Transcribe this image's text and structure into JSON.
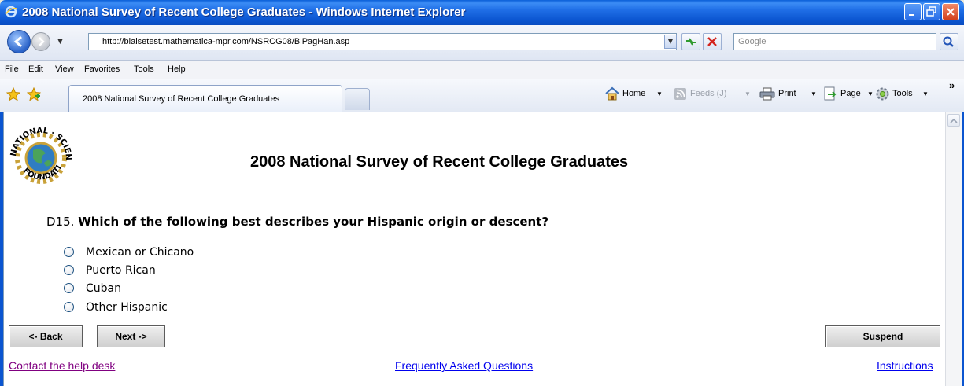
{
  "window": {
    "title": "2008 National Survey of Recent College Graduates - Windows Internet Explorer"
  },
  "address": {
    "url": "http://blaisetest.mathematica-mpr.com/NSRCG08/BiPagHan.asp",
    "search_placeholder": "Google"
  },
  "menu": [
    "File",
    "Edit",
    "View",
    "Favorites",
    "Tools",
    "Help"
  ],
  "tab": {
    "label": "2008 National Survey of Recent College Graduates"
  },
  "commands": {
    "home": "Home",
    "feeds": "Feeds (J)",
    "print": "Print",
    "page": "Page",
    "tools": "Tools",
    "more": "»"
  },
  "page": {
    "title": "2008 National Survey of Recent College Graduates",
    "logo_text": "NATIONAL SCIENCE FOUNDATION",
    "question_number": "D15.",
    "question_text": "Which of the following best describes your Hispanic origin or descent?",
    "options": [
      "Mexican or Chicano",
      "Puerto Rican",
      "Cuban",
      "Other Hispanic"
    ],
    "buttons": {
      "back": "<- Back",
      "next": "Next ->",
      "suspend": "Suspend"
    },
    "links": {
      "help": "Contact the help desk",
      "faq": "Frequently Asked Questions",
      "instructions": "Instructions"
    }
  },
  "colors": {
    "titlebar": "#0b55d0",
    "link_visited": "#800080",
    "link": "#0000ee"
  }
}
